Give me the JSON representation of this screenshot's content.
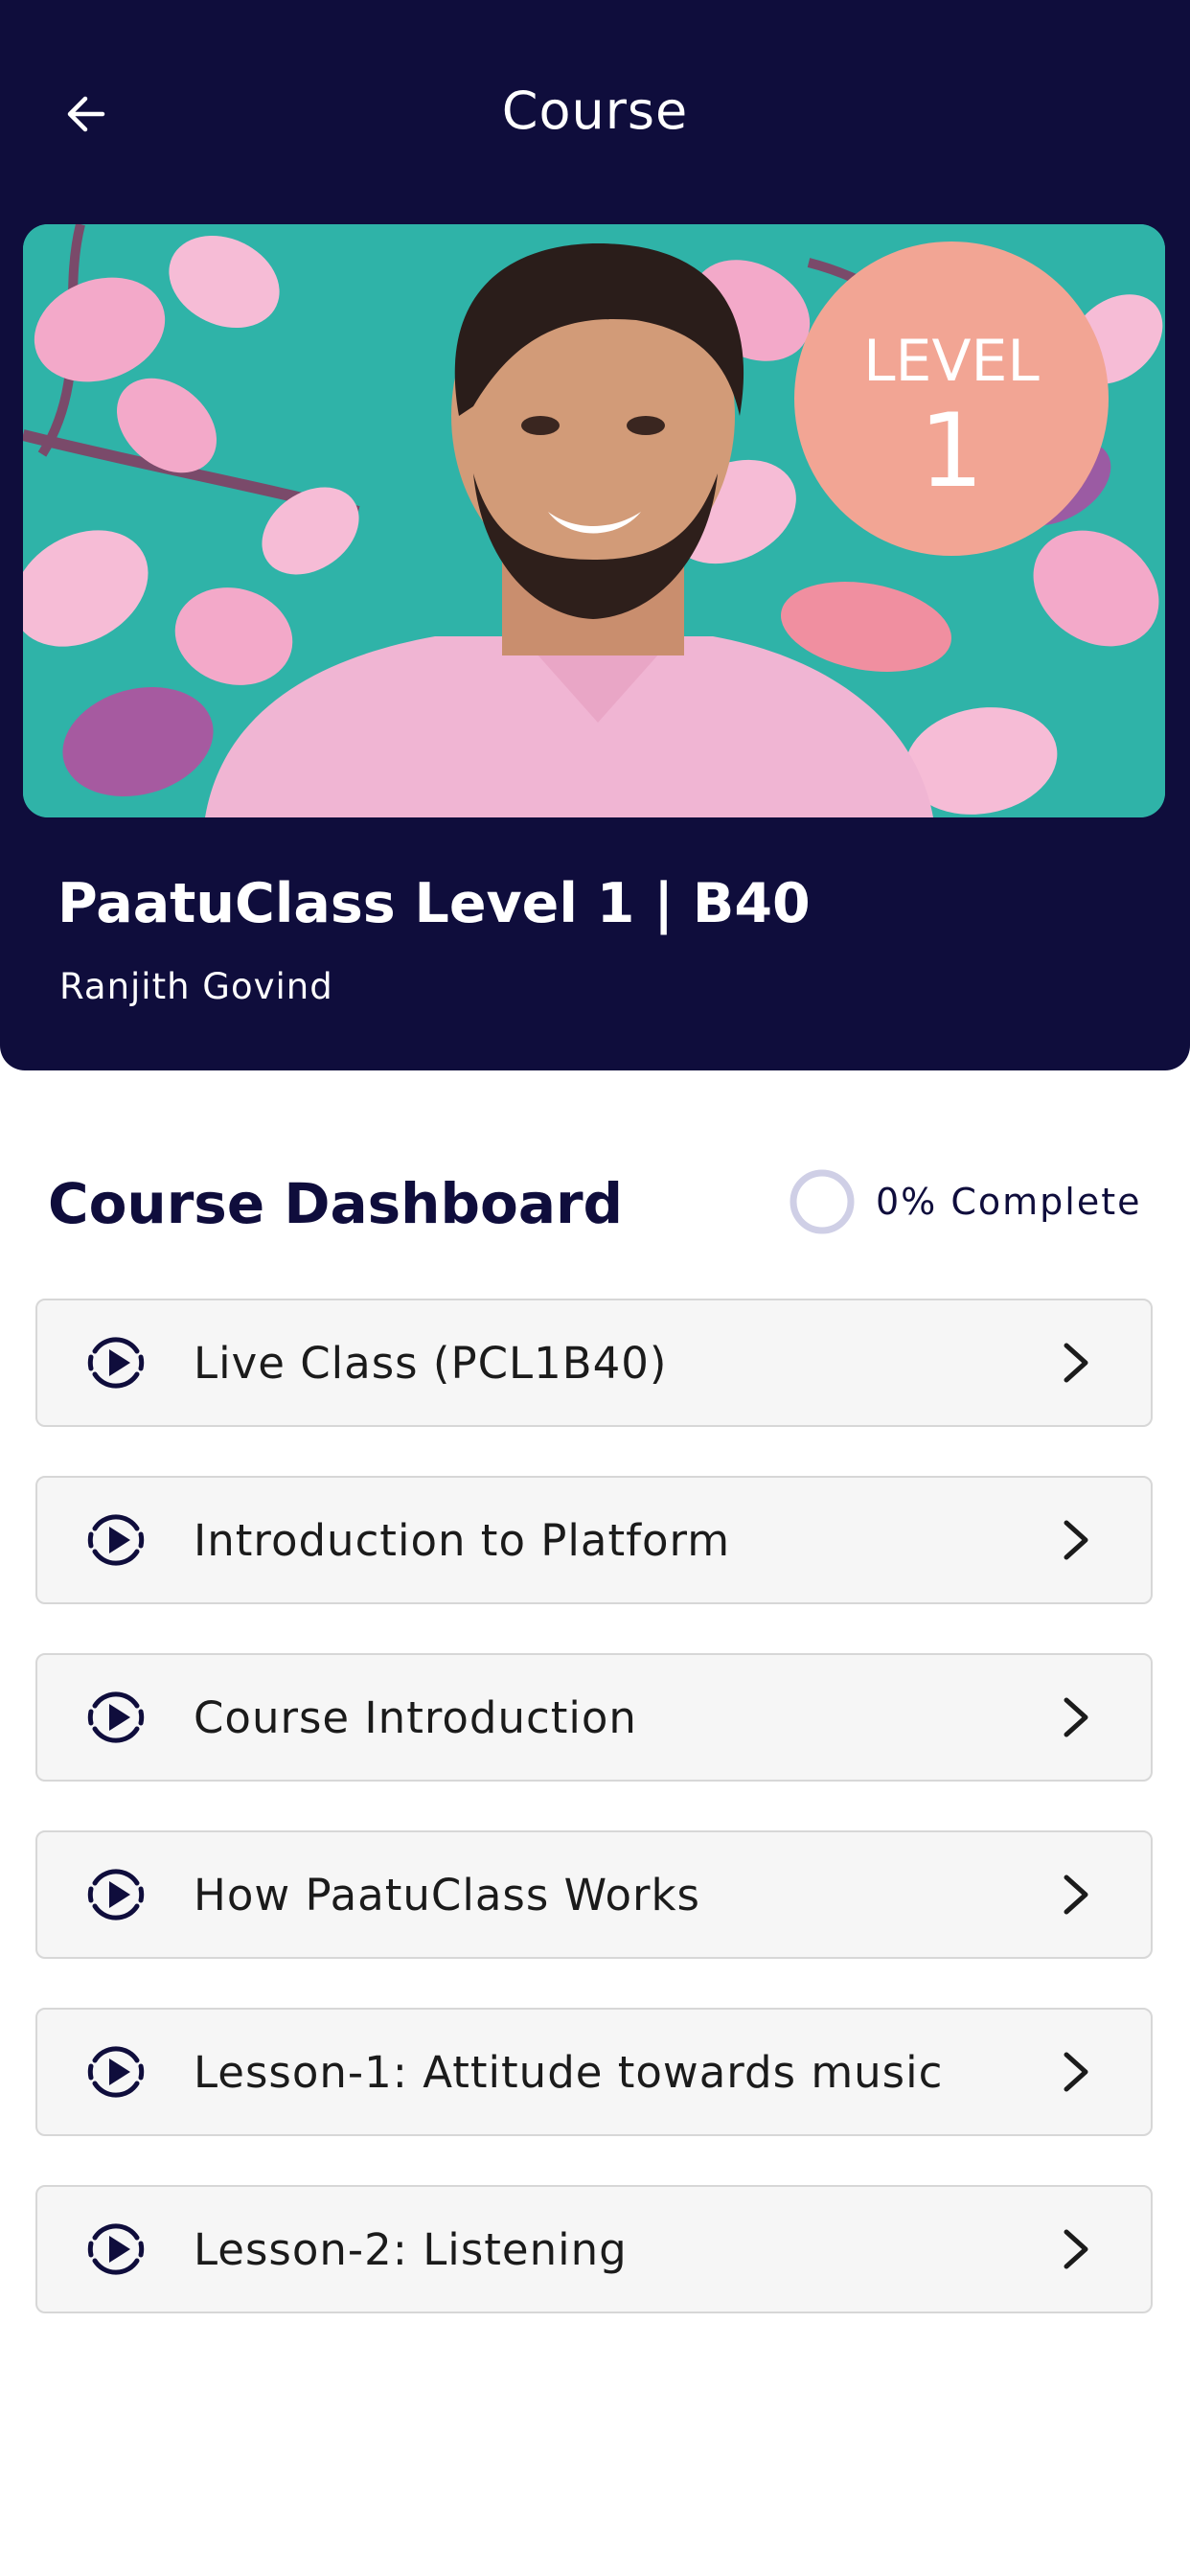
{
  "header": {
    "title": "Course",
    "back_icon": "arrow-left-icon"
  },
  "hero": {
    "badge_line1": "LEVEL",
    "badge_line2": "1",
    "image_subject": "instructor portrait on floral teal background"
  },
  "course": {
    "name": "PaatuClass Level 1 | B40",
    "instructor": "Ranjith Govind"
  },
  "dashboard": {
    "title": "Course Dashboard",
    "progress_text": "0% Complete",
    "progress_value": 0
  },
  "modules": [
    {
      "label": "Live Class (PCL1B40)",
      "icon": "play-circle-icon"
    },
    {
      "label": "Introduction to Platform",
      "icon": "play-circle-icon"
    },
    {
      "label": "Course Introduction",
      "icon": "play-circle-icon"
    },
    {
      "label": "How PaatuClass Works",
      "icon": "play-circle-icon"
    },
    {
      "label": "Lesson-1: Attitude towards music",
      "icon": "play-circle-icon"
    },
    {
      "label": "Lesson-2: Listening",
      "icon": "play-circle-icon"
    }
  ],
  "colors": {
    "navy": "#0f0d3c",
    "hero_teal": "#2fb3a8",
    "badge_pink": "#f2a594",
    "progress_ring": "#cfcfe6",
    "card_bg": "#f6f6f6",
    "card_border": "#d7d7d7"
  }
}
